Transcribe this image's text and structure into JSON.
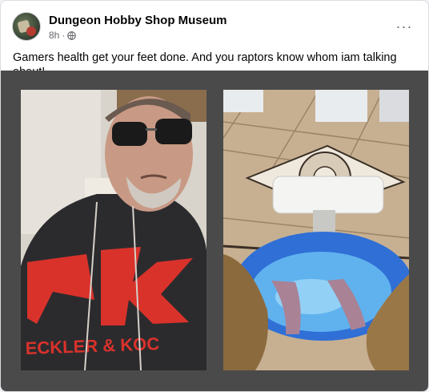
{
  "post": {
    "page_name": "Dungeon Hobby Shop Museum",
    "time": "8h",
    "separator": "·",
    "privacy_icon": "globe-icon",
    "more_icon": "more-horizontal-icon",
    "more_label": "···",
    "caption": "Gamers health get your feet done. And you raptors know whom iam talking about!"
  },
  "photos": [
    {
      "subject": "selfie",
      "hoodie_print": "ECKLER & KOC"
    },
    {
      "subject": "pedicure foot bath"
    }
  ],
  "colors": {
    "card": "#ffffff",
    "text": "#050505",
    "secondary_text": "#65676b",
    "media_background": "#4a4a4a"
  }
}
